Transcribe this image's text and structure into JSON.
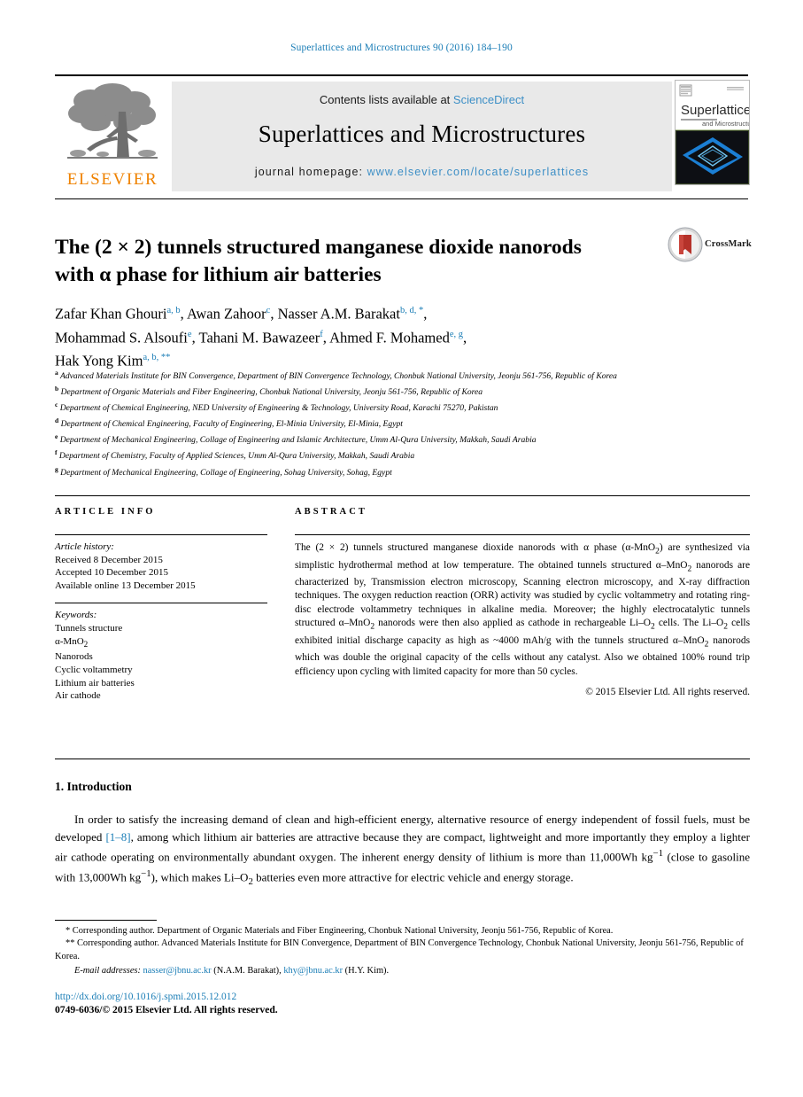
{
  "running_head": "Superlattices and Microstructures 90 (2016) 184–190",
  "masthead": {
    "publisher_logo_text": "ELSEVIER",
    "contents_prefix": "Contents lists available at ",
    "contents_link": "ScienceDirect",
    "journal_title": "Superlattices and Microstructures",
    "homepage_prefix": "journal homepage: ",
    "homepage_url": "www.elsevier.com/locate/superlattices",
    "cover_title_main": "Superlattices",
    "cover_title_sub": "and Microstructures"
  },
  "article": {
    "title_line1": "The (2 × 2) tunnels structured manganese dioxide nanorods",
    "title_line2": "with α phase for lithium air batteries",
    "crossmark_label": "CrossMark"
  },
  "authors": {
    "line1": [
      {
        "name": "Zafar Khan Ghouri",
        "sup": "a, b",
        "sep": ", "
      },
      {
        "name": "Awan Zahoor",
        "sup": "c",
        "sep": ", "
      },
      {
        "name": "Nasser A.M. Barakat",
        "sup": "b, d, *",
        "sep": ","
      }
    ],
    "line2": [
      {
        "name": "Mohammad S. Alsoufi",
        "sup": "e",
        "sep": ", "
      },
      {
        "name": "Tahani M. Bawazeer",
        "sup": "f",
        "sep": ", "
      },
      {
        "name": "Ahmed F. Mohamed",
        "sup": "e, g",
        "sep": ","
      }
    ],
    "line3": [
      {
        "name": "Hak Yong Kim",
        "sup": "a, b, **",
        "sep": ""
      }
    ]
  },
  "affiliations": [
    {
      "mark": "a",
      "text": "Advanced Materials Institute for BIN Convergence, Department of BIN Convergence Technology, Chonbuk National University, Jeonju 561-756, Republic of Korea"
    },
    {
      "mark": "b",
      "text": "Department of Organic Materials and Fiber Engineering, Chonbuk National University, Jeonju 561-756, Republic of Korea"
    },
    {
      "mark": "c",
      "text": "Department of Chemical Engineering, NED University of Engineering & Technology, University Road, Karachi 75270, Pakistan"
    },
    {
      "mark": "d",
      "text": "Department of Chemical Engineering, Faculty of Engineering, El-Minia University, El-Minia, Egypt"
    },
    {
      "mark": "e",
      "text": "Department of Mechanical Engineering, Collage of Engineering and Islamic Architecture, Umm Al-Qura University, Makkah, Saudi Arabia"
    },
    {
      "mark": "f",
      "text": "Department of Chemistry, Faculty of Applied Sciences, Umm Al-Qura University, Makkah, Saudi Arabia"
    },
    {
      "mark": "g",
      "text": "Department of Mechanical Engineering, Collage of Engineering, Sohag University, Sohag, Egypt"
    }
  ],
  "info": {
    "heading": "ARTICLE INFO",
    "history_label": "Article history:",
    "history": [
      "Received 8 December 2015",
      "Accepted 10 December 2015",
      "Available online 13 December 2015"
    ],
    "keywords_label": "Keywords:",
    "keywords": [
      "Tunnels structure",
      "α-MnO2",
      "Nanorods",
      "Cyclic voltammetry",
      "Lithium air batteries",
      "Air cathode"
    ]
  },
  "abstract": {
    "heading": "ABSTRACT",
    "text": "The (2 × 2) tunnels structured manganese dioxide nanorods with α phase (α-MnO2) are synthesized via simplistic hydrothermal method at low temperature. The obtained tunnels structured α–MnO2 nanorods are characterized by, Transmission electron microscopy, Scanning electron microscopy, and X-ray diffraction techniques. The oxygen reduction reaction (ORR) activity was studied by cyclic voltammetry and rotating ring-disc electrode voltammetry techniques in alkaline media. Moreover; the highly electrocatalytic tunnels structured α–MnO2 nanorods were then also applied as cathode in rechargeable Li–O2 cells. The Li–O2 cells exhibited initial discharge capacity as high as ~4000 mAh/g with the tunnels structured α–MnO2 nanorods which was double the original capacity of the cells without any catalyst. Also we obtained 100% round trip efficiency upon cycling with limited capacity for more than 50 cycles.",
    "copyright": "© 2015 Elsevier Ltd. All rights reserved."
  },
  "body": {
    "section_heading": "1. Introduction",
    "paragraph": "In order to satisfy the increasing demand of clean and high-efficient energy, alternative resource of energy independent of fossil fuels, must be developed [1–8], among which lithium air batteries are attractive because they are compact, lightweight and more importantly they employ a lighter air cathode operating on environmentally abundant oxygen. The inherent energy density of lithium is more than 11,000Wh kg−1 (close to gasoline with 13,000Wh kg−1), which makes Li–O2 batteries even more attractive for electric vehicle and energy storage.",
    "citation_link": "[1–8]"
  },
  "footnotes": {
    "corresponding_1": "* Corresponding author. Department of Organic Materials and Fiber Engineering, Chonbuk National University, Jeonju 561-756, Republic of Korea.",
    "corresponding_2": "** Corresponding author. Advanced Materials Institute for BIN Convergence, Department of BIN Convergence Technology, Chonbuk National University, Jeonju 561-756, Republic of Korea.",
    "email_label": "E-mail addresses:",
    "email_1": "nasser@jbnu.ac.kr",
    "email_1_owner": "(N.A.M. Barakat),",
    "email_2": "khy@jbnu.ac.kr",
    "email_2_owner": "(H.Y. Kim)."
  },
  "bottom": {
    "doi": "http://dx.doi.org/10.1016/j.spmi.2015.12.012",
    "issn_line": "0749-6036/© 2015 Elsevier Ltd. All rights reserved."
  },
  "colors": {
    "link_blue": "#1a7db6",
    "sciencedirect_blue": "#3d8fc6",
    "elsevier_orange": "#ef8200",
    "masthead_gray": "#e9e9e9",
    "crossmark_red": "#b5322a"
  }
}
